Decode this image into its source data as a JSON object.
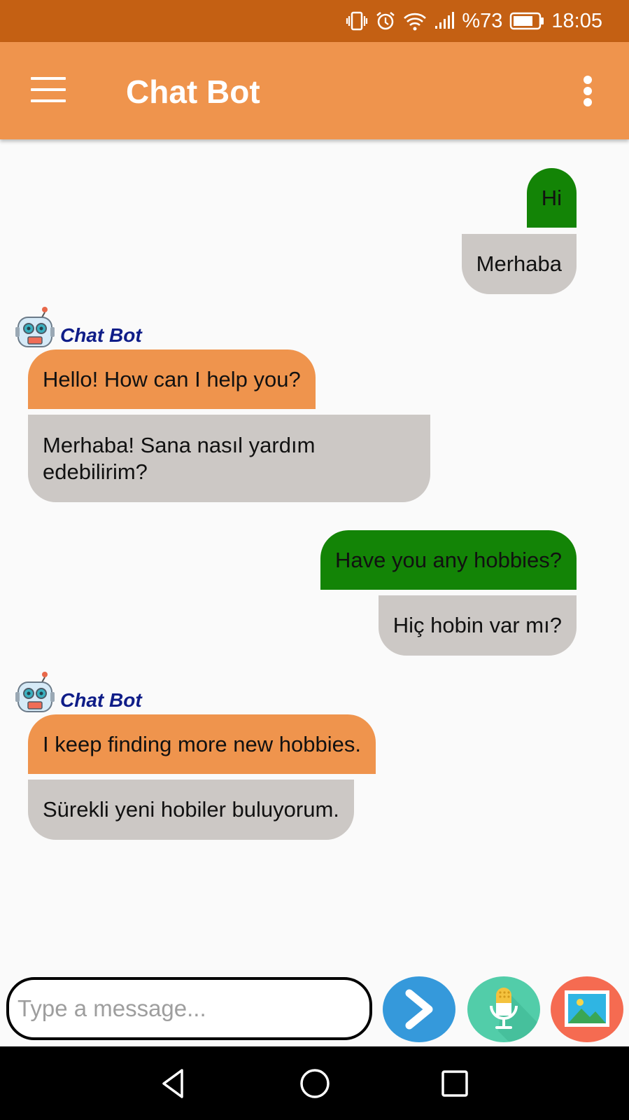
{
  "status_bar": {
    "battery_percent": "%73",
    "time": "18:05",
    "icons": [
      "vibrate-icon",
      "alarm-icon",
      "wifi-icon",
      "signal-icon",
      "battery-icon"
    ]
  },
  "app_bar": {
    "title": "Chat Bot",
    "icons": [
      "menu-icon",
      "more-options-icon"
    ]
  },
  "chat": {
    "bot_name": "Chat Bot",
    "messages": [
      {
        "from": "user",
        "text": "Hi",
        "translation": "Merhaba"
      },
      {
        "from": "bot",
        "text": "Hello! How can I help you?",
        "translation_lines": [
          "Merhaba! Sana nasıl yardım",
          "edebilirim?"
        ]
      },
      {
        "from": "user",
        "text": "Have you any hobbies?",
        "translation": "Hiç hobin var mı?"
      },
      {
        "from": "bot",
        "text": "I keep finding more new hobbies.",
        "translation": "Sürekli yeni hobiler buluyorum."
      }
    ]
  },
  "composer": {
    "placeholder": "Type a message...",
    "buttons": [
      "send-icon",
      "microphone-icon",
      "image-icon"
    ]
  },
  "nav_bar": {
    "buttons": [
      "back-icon",
      "home-icon",
      "recents-icon"
    ]
  },
  "colors": {
    "status_bar": "#c46013",
    "app_bar": "#ef944d",
    "user_bubble": "#138406",
    "bot_bubble": "#ef944d",
    "translation_bubble": "#ccc8c5",
    "bot_name": "#0f1d88",
    "send_button": "#3599db",
    "mic_button": "#52cda9",
    "image_button": "#f56b51"
  }
}
